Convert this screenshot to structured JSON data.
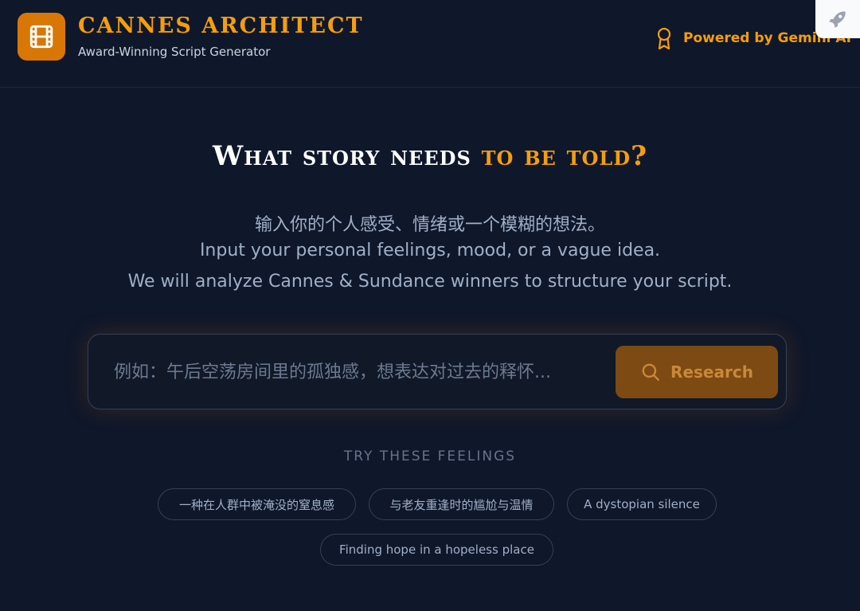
{
  "header": {
    "brand_title": "CANNES ARCHITECT",
    "brand_subtitle": "Award-Winning Script Generator",
    "powered_by": "Powered by Gemini AI",
    "logo_icon": "film-icon",
    "badge_icon": "award-icon",
    "corner_icon": "rocket-icon"
  },
  "hero": {
    "title_main": "What story needs ",
    "title_accent": "to be told?",
    "line_zh": "输入你的个人感受、情绪或一个模糊的想法。",
    "line_en1": "Input your personal feelings, mood, or a vague idea.",
    "line_en2": "We will analyze Cannes & Sundance winners to structure your script."
  },
  "search": {
    "value": "",
    "placeholder": "例如：午后空荡房间里的孤独感，想表达对过去的释怀...",
    "button_label": "Research",
    "button_icon": "search-icon"
  },
  "suggestions": {
    "label": "TRY THESE FEELINGS",
    "items": [
      "一种在人群中被淹没的窒息感",
      "与老友重逢时的尴尬与温情",
      "A dystopian silence",
      "Finding hope in a hopeless place"
    ]
  },
  "colors": {
    "background": "#0f172a",
    "accent": "#f59e0b",
    "button": "#7c4a12"
  }
}
